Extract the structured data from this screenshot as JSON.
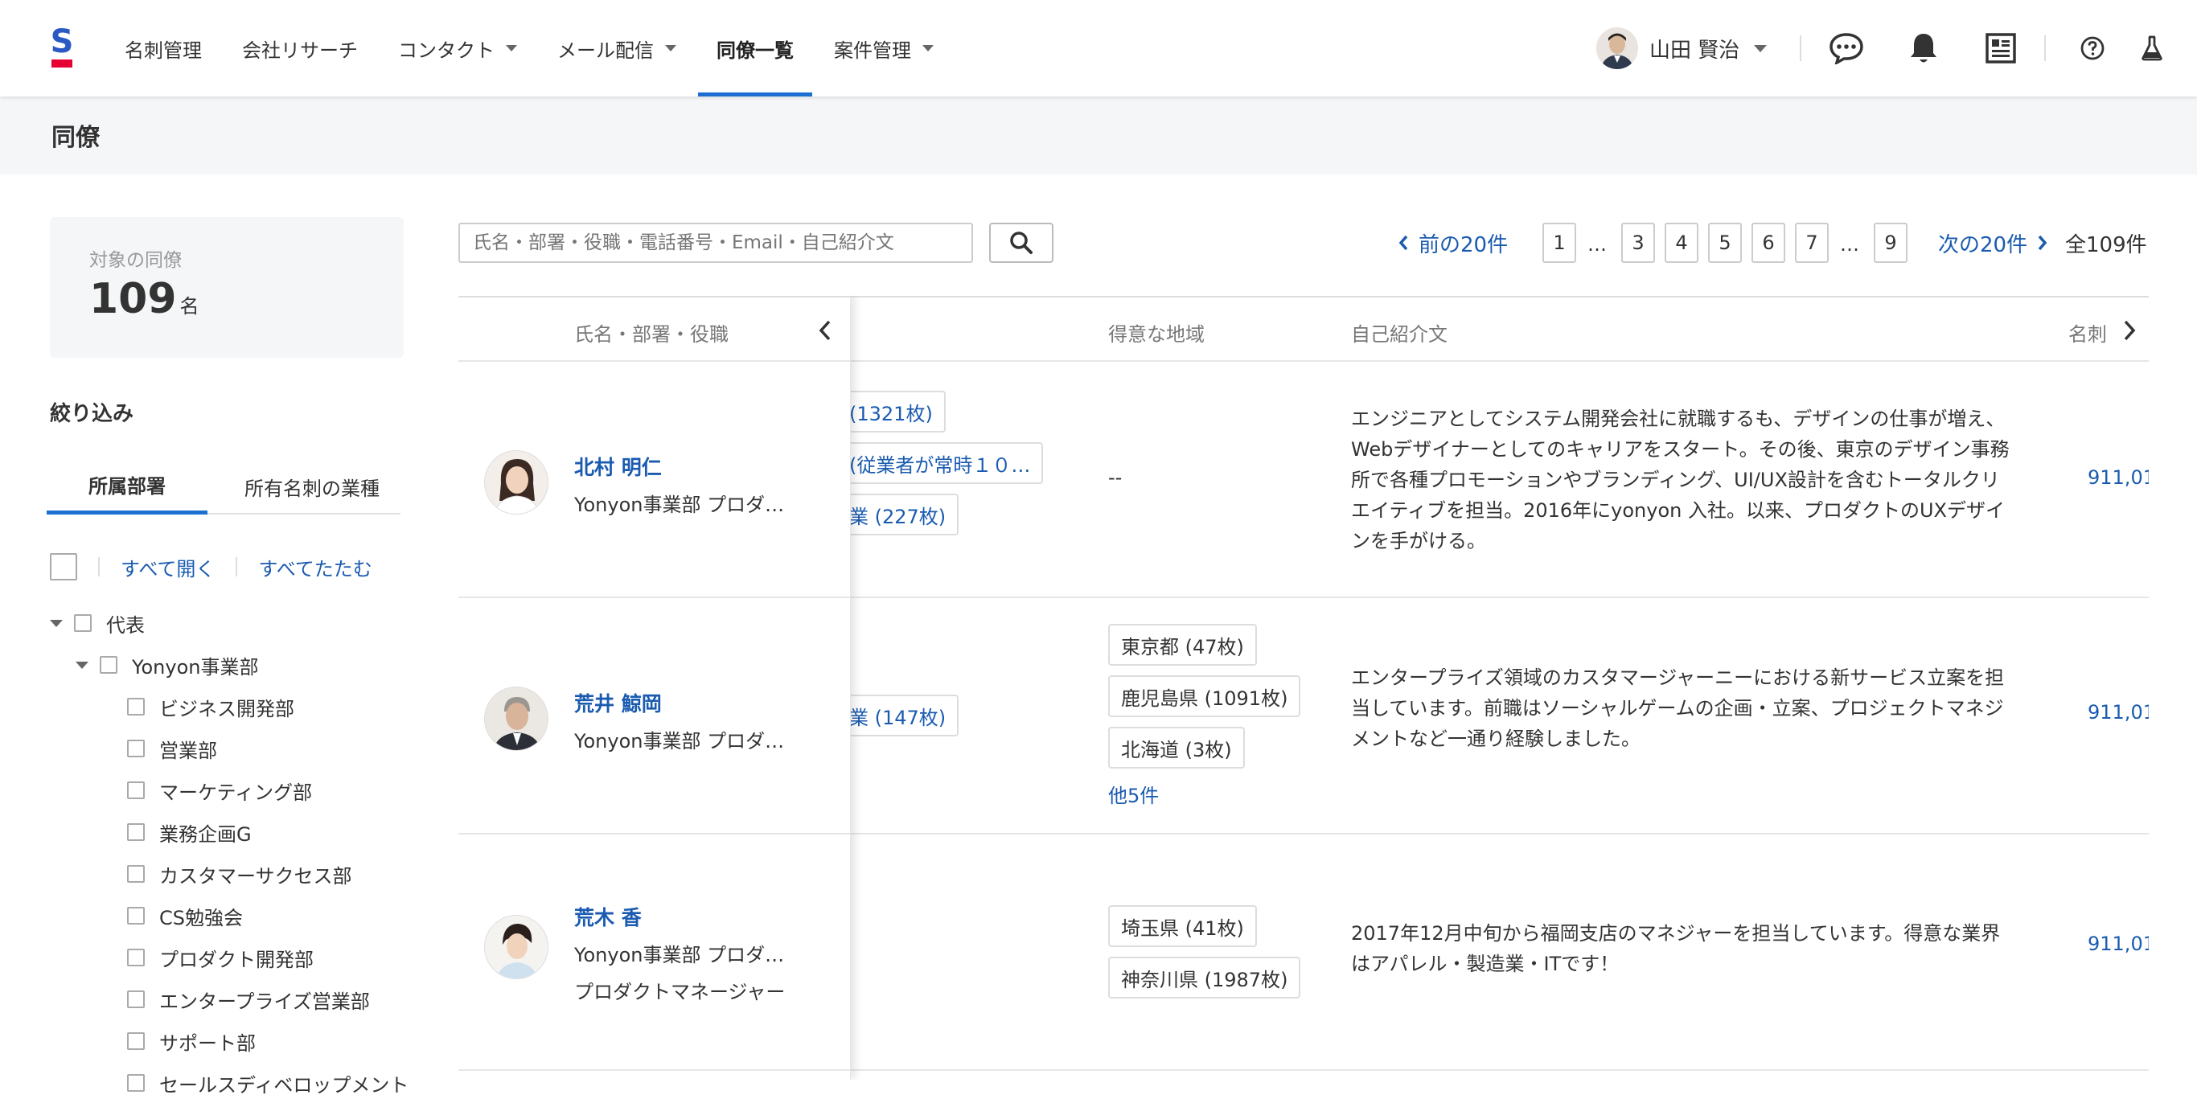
{
  "nav": {
    "items": [
      {
        "label": "名刺管理",
        "caret": false,
        "active": false
      },
      {
        "label": "会社リサーチ",
        "caret": false,
        "active": false
      },
      {
        "label": "コンタクト",
        "caret": true,
        "active": false
      },
      {
        "label": "メール配信",
        "caret": true,
        "active": false
      },
      {
        "label": "同僚一覧",
        "caret": false,
        "active": true
      },
      {
        "label": "案件管理",
        "caret": true,
        "active": false
      }
    ],
    "user_name": "山田 賢治"
  },
  "page": {
    "title": "同僚"
  },
  "sidebar": {
    "count_label": "対象の同僚",
    "count_value": "109",
    "count_unit": "名",
    "filter_title": "絞り込み",
    "tabs": [
      "所属部署",
      "所有名刺の業種"
    ],
    "expand_all": "すべて開く",
    "collapse_all": "すべてたたむ",
    "tree": [
      {
        "label": "代表",
        "level": 0,
        "arrow": true
      },
      {
        "label": "Yonyon事業部",
        "level": 1,
        "arrow": true
      },
      {
        "label": "ビジネス開発部",
        "level": 2,
        "arrow": false
      },
      {
        "label": "営業部",
        "level": 2,
        "arrow": false
      },
      {
        "label": "マーケティング部",
        "level": 2,
        "arrow": false
      },
      {
        "label": "業務企画G",
        "level": 2,
        "arrow": false
      },
      {
        "label": "カスタマーサクセス部",
        "level": 2,
        "arrow": false
      },
      {
        "label": "CS勉強会",
        "level": 2,
        "arrow": false
      },
      {
        "label": "プロダクト開発部",
        "level": 2,
        "arrow": false
      },
      {
        "label": "エンタープライズ営業部",
        "level": 2,
        "arrow": false
      },
      {
        "label": "サポート部",
        "level": 2,
        "arrow": false
      },
      {
        "label": "セールスディベロップメント",
        "level": 2,
        "arrow": false
      }
    ]
  },
  "search": {
    "placeholder": "氏名・部署・役職・電話番号・Email・自己紹介文"
  },
  "pagination": {
    "prev": "前の20件",
    "next": "次の20件",
    "pages": [
      "1",
      "3",
      "4",
      "5",
      "6",
      "7",
      "9"
    ],
    "ellipsis": "…",
    "total": "全109件"
  },
  "table": {
    "headers": {
      "name": "氏名・部署・役職",
      "region": "得意な地域",
      "intro": "自己紹介文",
      "cards": "名刺"
    },
    "rows": [
      {
        "name": "北村 明仁",
        "dept": "Yonyon事業部 プロダ…",
        "title": "",
        "industry_tags": [
          "(1321枚)",
          "(従業者が常時１０…",
          "業 (227枚)"
        ],
        "regions": [],
        "region_empty": "--",
        "more": "",
        "intro": "エンジニアとしてシステム開発会社に就職するも、デザインの仕事が増え、Webデザイナーとしてのキャリアをスタート。その後、東京のデザイン事務所で各種プロモーションやブランディング、UI/UX設計を含むトータルクリエイティブを担当。2016年にyonyon 入社。以来、プロダクトのUXデザインを手がける。",
        "cards": "911,01"
      },
      {
        "name": "荒井 鯨岡",
        "dept": "Yonyon事業部 プロダ…",
        "title": "",
        "industry_tags": [
          "業 (147枚)"
        ],
        "regions": [
          "東京都 (47枚)",
          "鹿児島県 (1091枚)",
          "北海道 (3枚)"
        ],
        "region_empty": "",
        "more": "他5件",
        "intro": "エンタープライズ領域のカスタマージャーニーにおける新サービス立案を担当しています。前職はソーシャルゲームの企画・立案、プロジェクトマネジメントなど一通り経験しました。",
        "cards": "911,01"
      },
      {
        "name": "荒木 香",
        "dept": "Yonyon事業部 プロダ…",
        "title": "プロダクトマネージャー",
        "industry_tags": [],
        "regions": [
          "埼玉県 (41枚)",
          "神奈川県 (1987枚)"
        ],
        "region_empty": "",
        "more": "",
        "intro": "2017年12月中旬から福岡支店のマネジャーを担当しています。得意な業界はアパレル・製造業・ITです！",
        "cards": "911,01"
      }
    ]
  },
  "colors": {
    "accent": "#1a6fd1",
    "link": "#1a5bb0",
    "logo_blue": "#2b59c3",
    "logo_red": "#e60033"
  }
}
